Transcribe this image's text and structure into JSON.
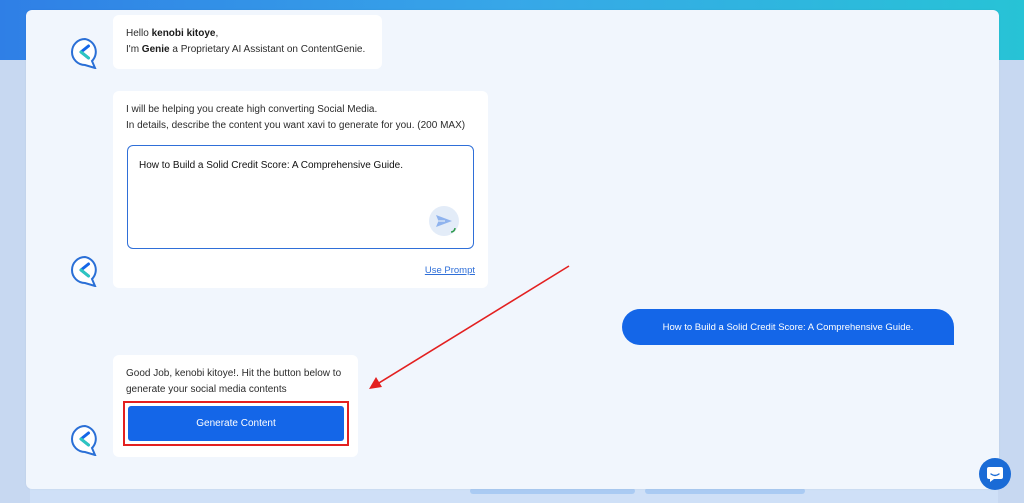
{
  "greeting": {
    "hello": "Hello ",
    "user_name": "kenobi kitoye",
    "comma": ",",
    "line2_prefix": "I'm ",
    "assistant_name": "Genie",
    "line2_suffix": " a Proprietary AI Assistant on ContentGenie."
  },
  "prompt_card": {
    "line1": "I will be helping you create high converting Social Media.",
    "line2": "In details, describe the content you want xavi to generate for you. (200 MAX)",
    "input_value": "How to Build a Solid Credit Score: A Comprehensive Guide.",
    "use_prompt_label": "Use Prompt"
  },
  "user_message": {
    "text": "How to Build a Solid Credit Score: A Comprehensive Guide."
  },
  "result_card": {
    "line1": "Good Job, kenobi kitoye!. Hit the button below to",
    "line2": "generate your social media contents",
    "button_label": "Generate Content"
  },
  "icons": {
    "avatar": "genie-logo-icon",
    "send": "send-icon",
    "support": "chat-support-icon"
  },
  "colors": {
    "accent": "#1466e8",
    "highlight": "#e32020"
  }
}
